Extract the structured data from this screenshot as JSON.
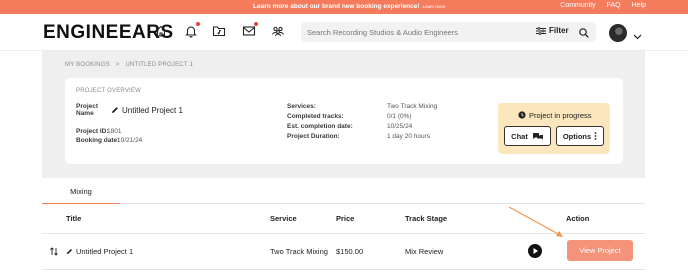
{
  "topbar": {
    "announcement": "Learn more about our brand new booking experience!",
    "announcement_link": "Learn more",
    "links": [
      "Community",
      "FAQ",
      "Help"
    ]
  },
  "header": {
    "logo": "ENGINEEARS",
    "nav_icons": [
      "home-icon",
      "bell-icon",
      "music-folder-icon",
      "mail-icon",
      "users-icon"
    ],
    "search_placeholder": "Search Recording Studios & Audio Engineers",
    "filter_label": "Filter"
  },
  "breadcrumb": {
    "parent": "MY BOOKINGS",
    "separator": ">",
    "current": "UNTITLED PROJECT 1"
  },
  "overview": {
    "title": "PROJECT OVERVIEW",
    "project_name_label": "Project Name",
    "project_name": "Untitled Project 1",
    "project_id_label": "Project ID:",
    "project_id": "1801",
    "booking_date_label": "Booking date:",
    "booking_date": "10/21/24",
    "services_label": "Services:",
    "services": "Two Track Mixing",
    "completed_label": "Completed tracks:",
    "completed": "0/1 (0%)",
    "est_label": "Est. completion date:",
    "est": "10/25/24",
    "duration_label": "Project Duration:",
    "duration": "1 day 20 hours",
    "status": "Project in progress",
    "chat_label": "Chat",
    "options_label": "Options"
  },
  "tabs": [
    "Mixing"
  ],
  "table": {
    "headers": {
      "title": "Title",
      "service": "Service",
      "price": "Price",
      "stage": "Track Stage",
      "action": "Action"
    },
    "rows": [
      {
        "title": "Untitled Project 1",
        "service": "Two Track Mixing",
        "price": "$150.00",
        "stage": "Mix Review",
        "action": "View Project"
      }
    ]
  },
  "colors": {
    "brand": "#f47c5c",
    "button": "#f4937a",
    "status_bg": "#fbe6bd",
    "page_bg": "#f0efef"
  }
}
